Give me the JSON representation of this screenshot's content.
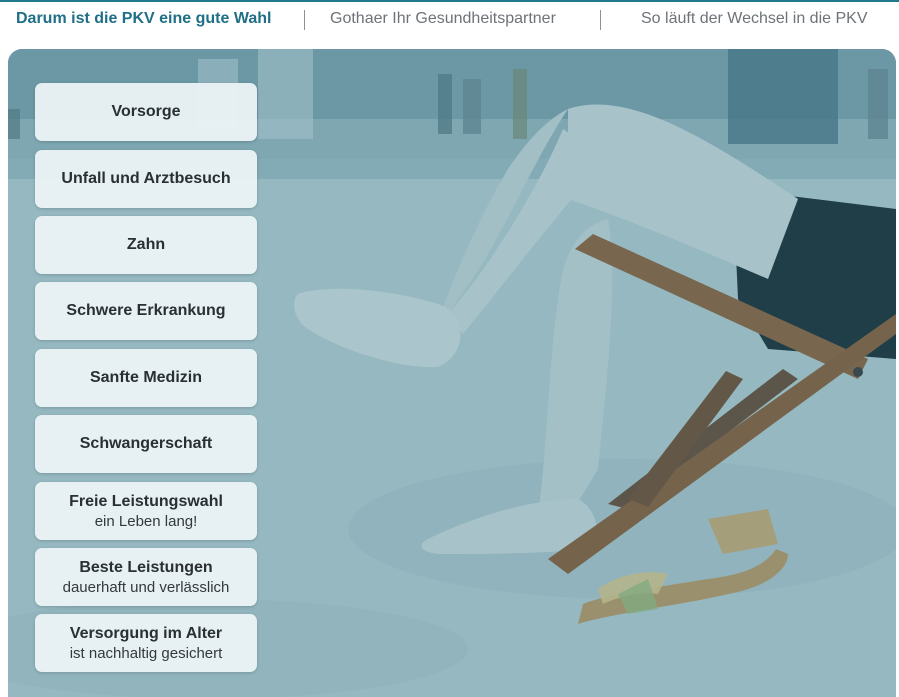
{
  "nav": {
    "tabs": [
      {
        "label": "Darum ist die PKV eine gute Wahl",
        "active": true
      },
      {
        "label": "Gothaer Ihr Gesundheitspartner",
        "active": false
      },
      {
        "label": "So läuft der Wechsel in die PKV",
        "active": false
      }
    ]
  },
  "menu": {
    "items": [
      {
        "label": "Vorsorge",
        "sub": ""
      },
      {
        "label": "Unfall und Arztbesuch",
        "sub": ""
      },
      {
        "label": "Zahn",
        "sub": ""
      },
      {
        "label": "Schwere Erkrankung",
        "sub": ""
      },
      {
        "label": "Sanfte Medizin",
        "sub": ""
      },
      {
        "label": "Schwangerschaft",
        "sub": ""
      },
      {
        "label": "Freie Leistungswahl",
        "sub": "ein Leben lang!"
      },
      {
        "label": "Beste Leistungen",
        "sub": "dauerhaft und verlässlich"
      },
      {
        "label": "Versorgung im Alter",
        "sub": "ist nachhaltig gesichert"
      }
    ]
  },
  "colors": {
    "accent": "#1f6f86",
    "inactive_tab": "#6d7378",
    "button_bg": "#eaf2f5",
    "overlay_tint": "#2e7f92"
  }
}
